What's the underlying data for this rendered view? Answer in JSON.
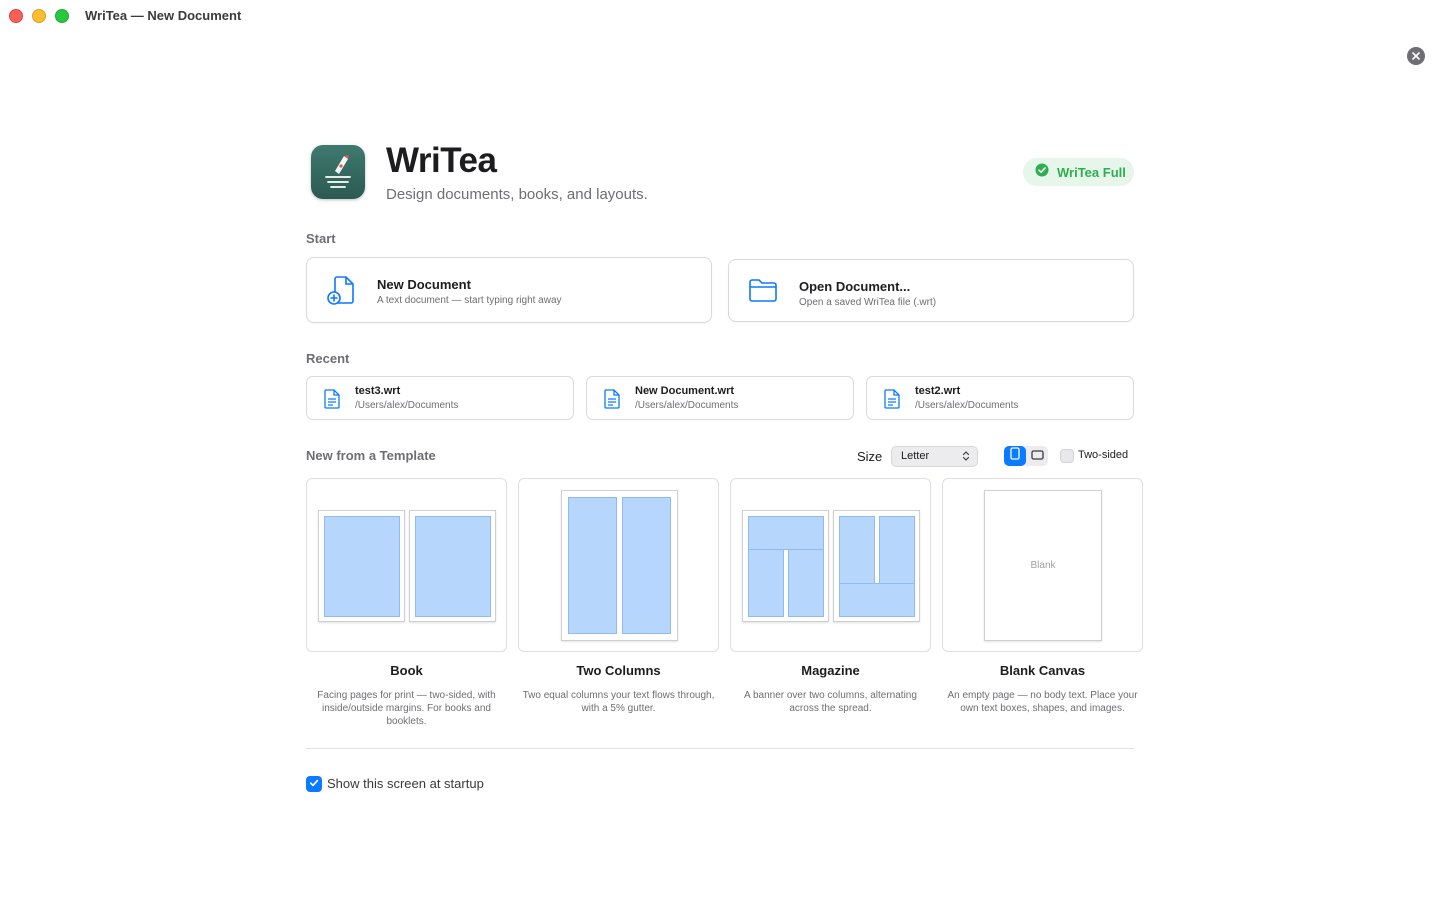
{
  "window": {
    "title": "WriTea — New Document"
  },
  "header": {
    "app_name": "WriTea",
    "tagline": "Design documents, books, and layouts.",
    "license_badge": "WriTea Full",
    "app_icon": "pen-nib-icon",
    "badge_icon": "check-seal-icon"
  },
  "start": {
    "label": "Start",
    "cards": [
      {
        "title": "New Document",
        "subtitle": "A text document — start typing right away",
        "icon": "new-document-icon"
      },
      {
        "title": "Open Document...",
        "subtitle": "Open a saved WriTea file (.wrt)",
        "icon": "folder-icon"
      }
    ]
  },
  "recent": {
    "label": "Recent",
    "items": [
      {
        "name": "test3.wrt",
        "path": "/Users/alex/Documents",
        "icon": "document-icon"
      },
      {
        "name": "New Document.wrt",
        "path": "/Users/alex/Documents",
        "icon": "document-icon"
      },
      {
        "name": "test2.wrt",
        "path": "/Users/alex/Documents",
        "icon": "document-icon"
      }
    ]
  },
  "templates": {
    "label": "New from a Template",
    "size_label": "Size",
    "size_value": "Letter",
    "orientation": "portrait",
    "two_sided_label": "Two-sided",
    "two_sided_checked": false,
    "items": [
      {
        "title": "Book",
        "description": "Facing pages for print — two-sided, with inside/outside margins. For books and booklets."
      },
      {
        "title": "Two Columns",
        "description": "Two equal columns your text flows through, with a 5% gutter."
      },
      {
        "title": "Magazine",
        "description": "A banner over two columns, alternating across the spread."
      },
      {
        "title": "Blank Canvas",
        "description": "An empty page — no body text. Place your own text boxes, shapes, and images.",
        "preview_text": "Blank"
      }
    ]
  },
  "footer": {
    "show_at_startup_label": "Show this screen at startup",
    "show_at_startup_checked": true
  },
  "colors": {
    "accent": "#0a7aff",
    "badge_green": "#2fae4f",
    "badge_bg": "#e6f6ea",
    "icon_teal": "#2f655d",
    "template_block": "#b7d6fb"
  }
}
